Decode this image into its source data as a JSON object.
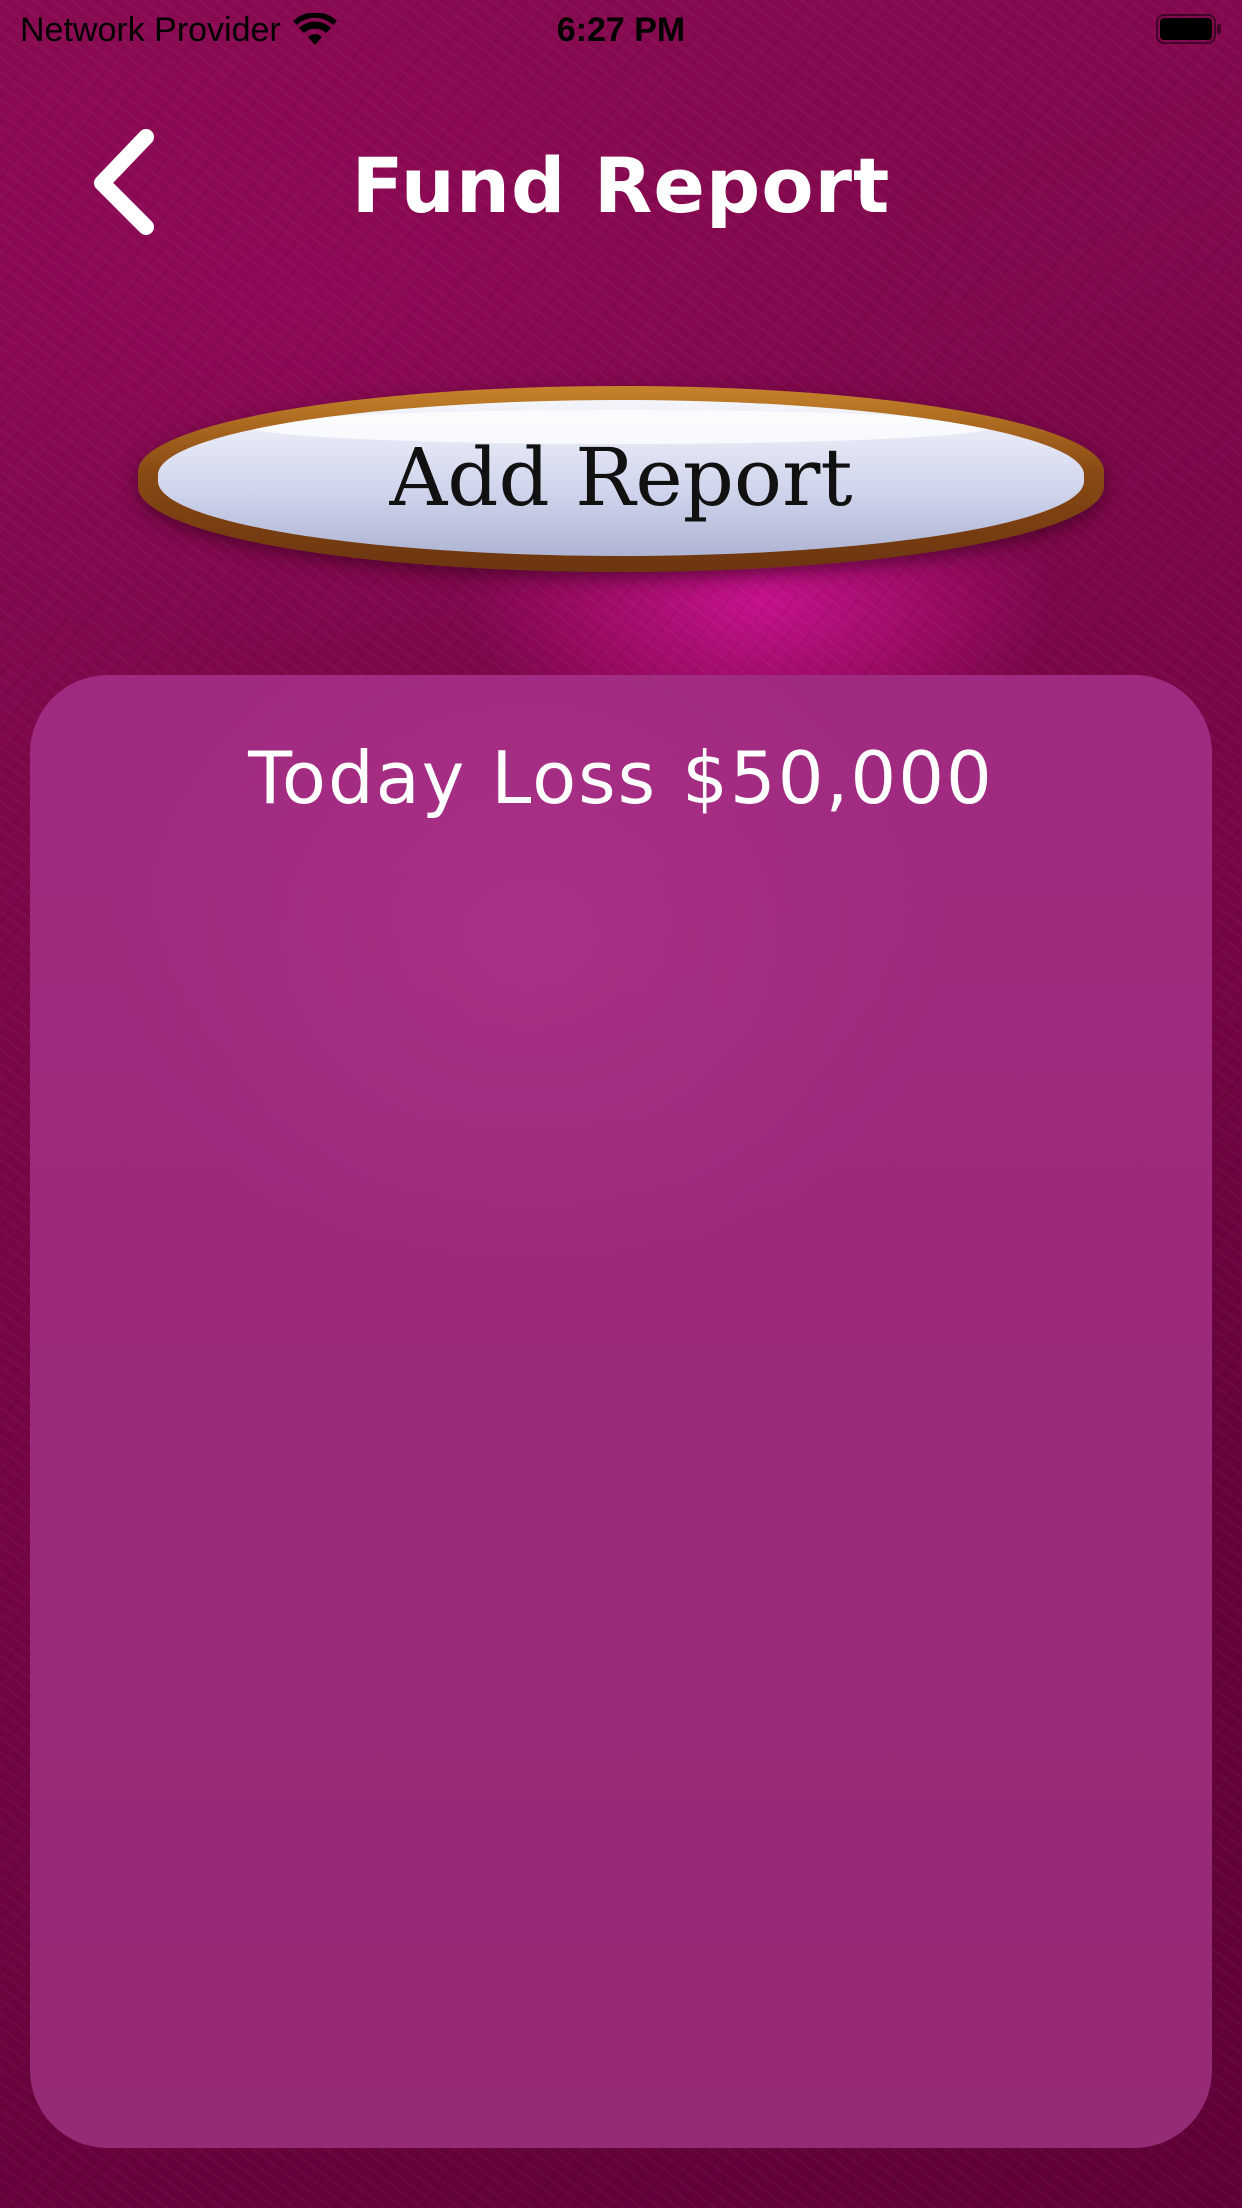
{
  "status_bar": {
    "carrier": "Network Provider",
    "time": "6:27 PM",
    "wifi_icon": "wifi-icon",
    "battery_icon": "battery-icon"
  },
  "nav": {
    "title": "Fund Report",
    "back_icon": "chevron-left-icon"
  },
  "actions": {
    "add_report_label": "Add Report"
  },
  "report": {
    "summary": "Today Loss $50,000"
  },
  "colors": {
    "background": "#7a0647",
    "panel": "#9a2a7b",
    "button_face": "#dfe2f2",
    "button_rim": "#8a4a14",
    "title_text": "#ffffff"
  }
}
